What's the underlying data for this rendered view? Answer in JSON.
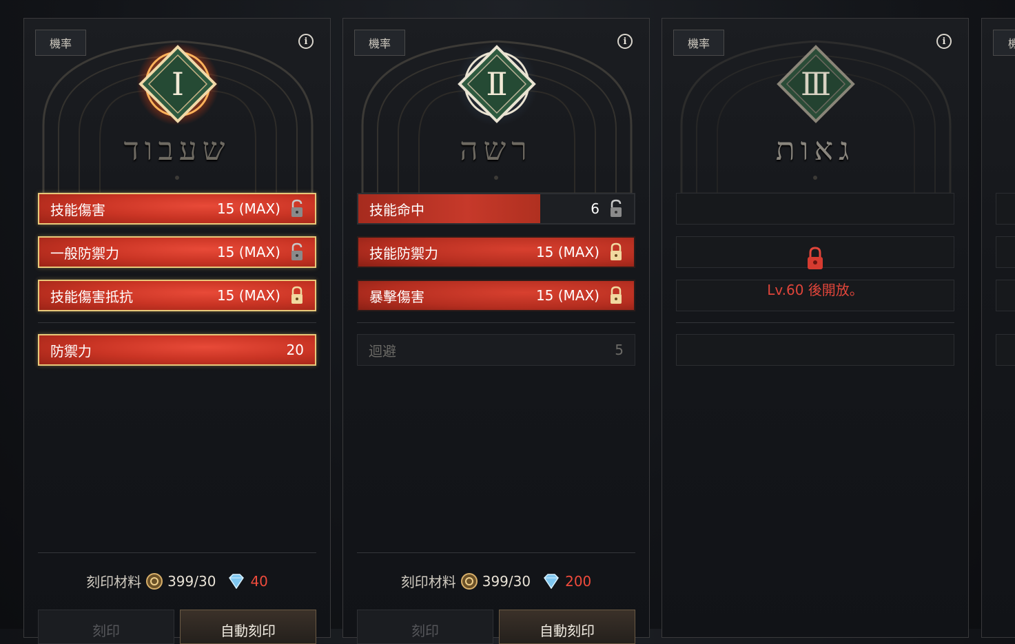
{
  "panels": [
    {
      "tag": "機率",
      "numeral": "Ⅰ",
      "hebrew": "שעבוד",
      "stats": [
        {
          "label": "技能傷害",
          "value": "15 (MAX)",
          "lock": "unlocked"
        },
        {
          "label": "一般防禦力",
          "value": "15 (MAX)",
          "lock": "unlocked"
        },
        {
          "label": "技能傷害抵抗",
          "value": "15 (MAX)",
          "lock": "locked"
        }
      ],
      "extra": {
        "label": "防禦力",
        "value": "20"
      },
      "cost": {
        "label": "刻印材料",
        "material": "399/30",
        "gems": "40"
      },
      "buttons": {
        "engrave": "刻印",
        "auto": "自動刻印"
      }
    },
    {
      "tag": "機率",
      "numeral": "Ⅱ",
      "hebrew": "רשה",
      "stats": [
        {
          "label": "技能命中",
          "value": "6",
          "lock": "unlocked",
          "progress": 0.66
        },
        {
          "label": "技能防禦力",
          "value": "15 (MAX)",
          "lock": "locked"
        },
        {
          "label": "暴擊傷害",
          "value": "15 (MAX)",
          "lock": "locked"
        }
      ],
      "extra": {
        "label": "迴避",
        "value": "5"
      },
      "cost": {
        "label": "刻印材料",
        "material": "399/30",
        "gems": "200"
      },
      "buttons": {
        "engrave": "刻印",
        "auto": "自動刻印"
      }
    },
    {
      "tag": "機率",
      "numeral": "Ⅲ",
      "hebrew": "גאות",
      "locked_message": "Lv.60 後開放。"
    },
    {
      "tag": "機"
    }
  ],
  "colors": {
    "accent_red": "#d8402f",
    "gold_border": "#e8c97a",
    "locked_text": "#e0453a",
    "gem_red": "#ef4b3c"
  }
}
